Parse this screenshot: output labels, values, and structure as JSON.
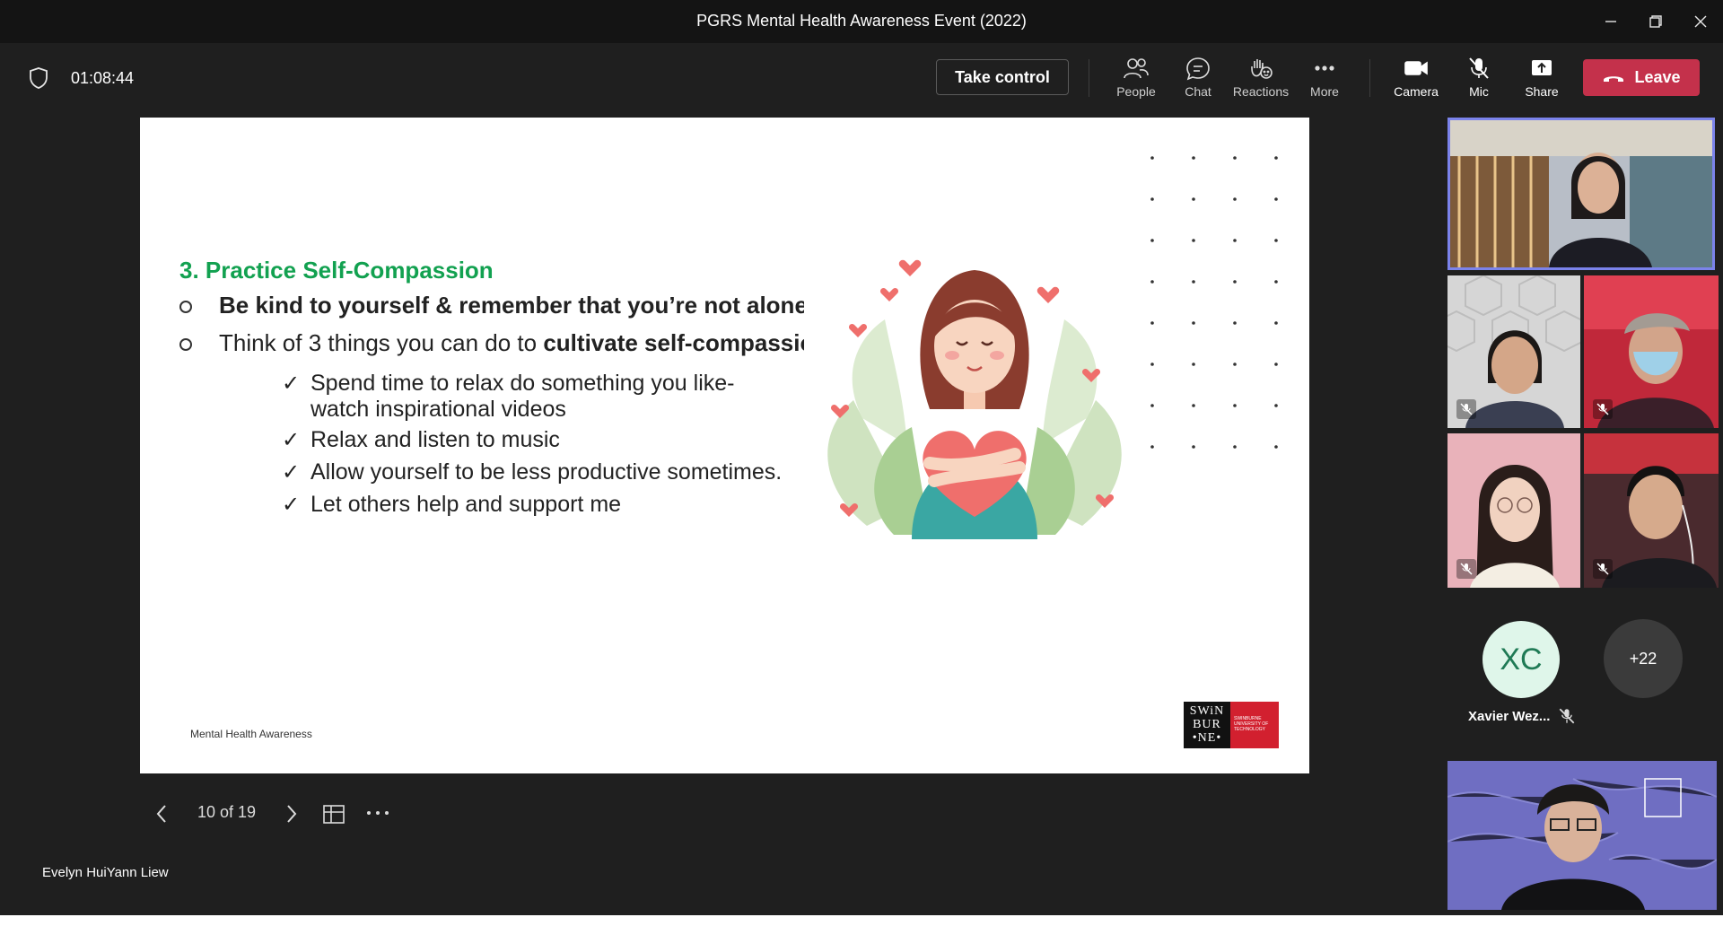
{
  "window": {
    "title": "PGRS Mental Health Awareness Event (2022)"
  },
  "toolbar": {
    "timer": "01:08:44",
    "take_control_label": "Take control",
    "buttons": [
      {
        "label": "People",
        "icon": "people-icon"
      },
      {
        "label": "Chat",
        "icon": "chat-icon"
      },
      {
        "label": "Reactions",
        "icon": "reactions-icon"
      },
      {
        "label": "More",
        "icon": "more-icon"
      },
      {
        "label": "Camera",
        "icon": "camera-icon"
      },
      {
        "label": "Mic",
        "icon": "mic-off-icon"
      },
      {
        "label": "Share",
        "icon": "share-icon"
      }
    ],
    "leave_label": "Leave",
    "leave_color": "#c4314b"
  },
  "slide": {
    "heading": "3. Practice Self-Compassion",
    "heading_color": "#12a150",
    "bullets": [
      {
        "text": "Be kind to yourself & remember that you’re not alone"
      },
      {
        "text_plain": "Think of 3 things you can do to ",
        "text_bold": "cultivate self-compassion"
      }
    ],
    "checks": [
      "Spend time to relax do something you like- watch inspirational videos",
      "Relax and listen to music",
      "Allow yourself to be less productive sometimes.",
      "Let others help and support me"
    ],
    "footer": "Mental Health Awareness",
    "logo_text": [
      "SWiN",
      "BUR",
      "•NE•"
    ],
    "logo_subtext": "SWINBURNE UNIVERSITY OF TECHNOLOGY"
  },
  "slide_nav": {
    "page_indicator": "10 of 19"
  },
  "presenter_name": "Evelyn HuiYann Liew",
  "participants": {
    "avatar_initials": "XC",
    "avatar_name": "Xavier Wez...",
    "overflow_count": "+22"
  }
}
